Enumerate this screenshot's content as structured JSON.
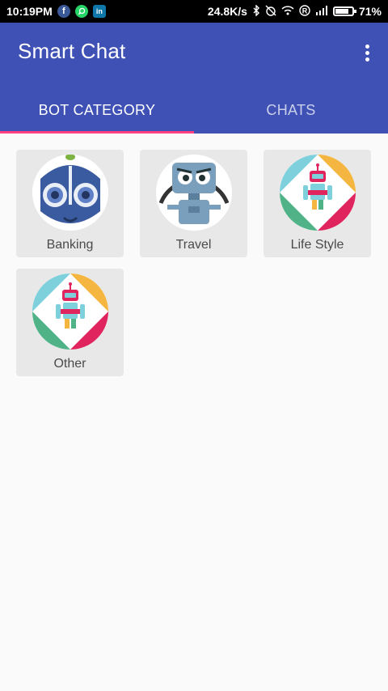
{
  "status_bar": {
    "time": "10:19PM",
    "network_speed": "24.8K/s",
    "battery_percent": "71%",
    "battery_level": 0.71,
    "icons": [
      "facebook-icon",
      "whatsapp-icon",
      "linkedin-icon",
      "bluetooth-icon",
      "alarm-off-icon",
      "wifi-icon",
      "registered-icon",
      "signal-icon",
      "battery-icon"
    ]
  },
  "app_bar": {
    "title": "Smart Chat",
    "menu_icon": "overflow-menu-icon",
    "color": "#3f51b5"
  },
  "tabs": [
    {
      "label": "BOT CATEGORY",
      "active": true
    },
    {
      "label": "CHATS",
      "active": false
    }
  ],
  "accent_color": "#ff4081",
  "categories": [
    {
      "label": "Banking",
      "icon": "owl-bot-icon"
    },
    {
      "label": "Travel",
      "icon": "grumpy-robot-icon"
    },
    {
      "label": "Life Style",
      "icon": "colorful-robot-icon"
    },
    {
      "label": "Other",
      "icon": "colorful-robot-icon"
    }
  ]
}
